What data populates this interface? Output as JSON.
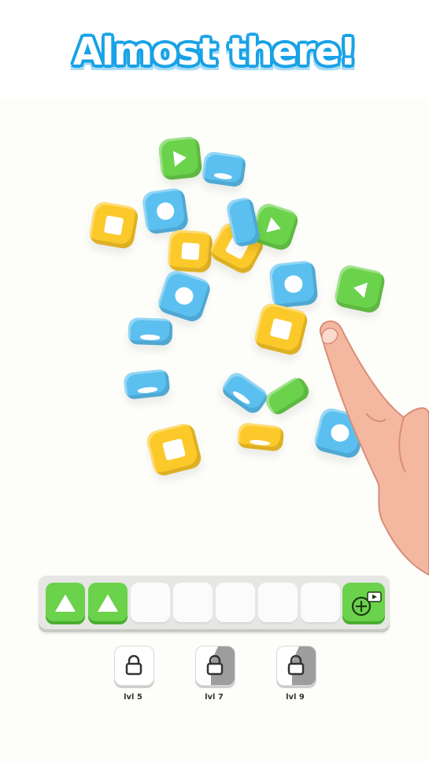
{
  "title": "Almost there!",
  "colors": {
    "yellow": "#fcc92a",
    "blue": "#5bc0f0",
    "green": "#6bd24b",
    "title_outline": "#19a2e6"
  },
  "tray": {
    "slots": [
      {
        "state": "filled",
        "symbol": "triangle"
      },
      {
        "state": "filled",
        "symbol": "triangle"
      },
      {
        "state": "empty"
      },
      {
        "state": "empty"
      },
      {
        "state": "empty"
      },
      {
        "state": "empty"
      },
      {
        "state": "empty"
      }
    ],
    "add_slot_icon": "add-slot-video-icon"
  },
  "boosters": [
    {
      "label": "lvl 5",
      "icon": "lock-icon"
    },
    {
      "label": "lvl 7",
      "icon": "lock-icon"
    },
    {
      "label": "lvl 9",
      "icon": "lock-icon"
    }
  ]
}
